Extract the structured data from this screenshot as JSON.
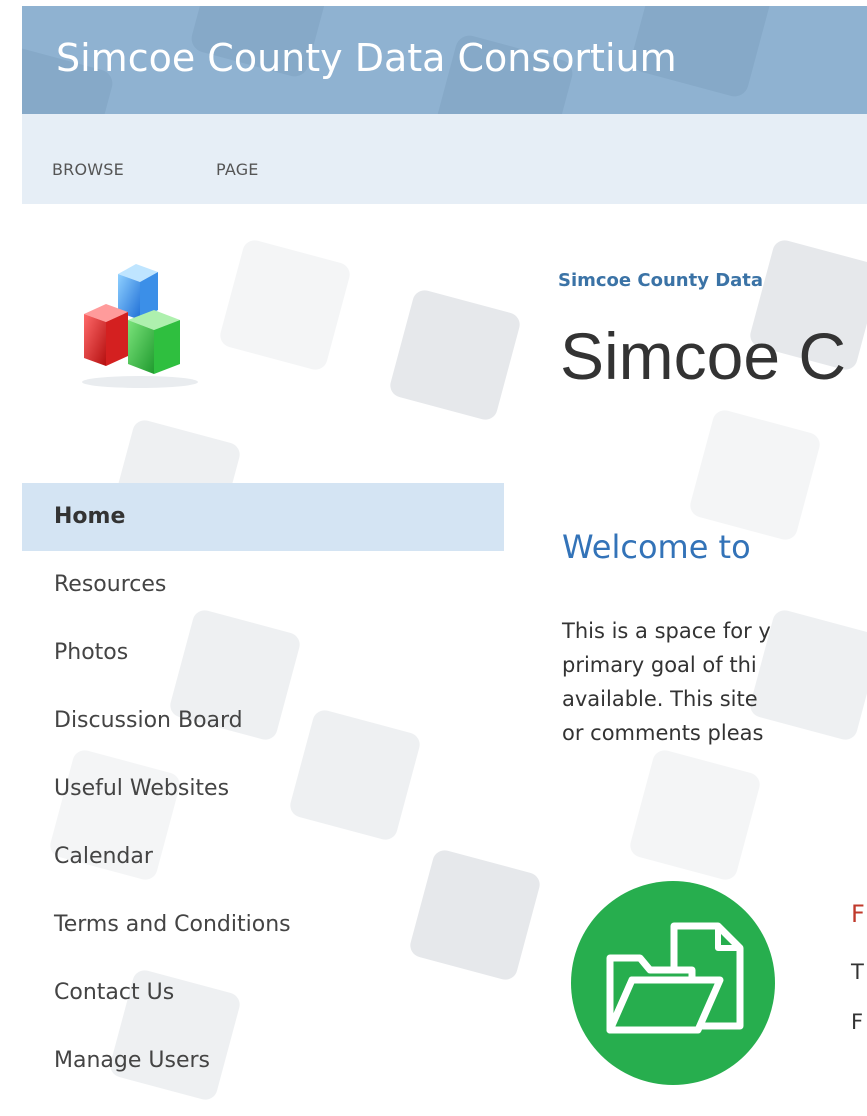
{
  "site": {
    "title": "Simcoe County Data Consortium"
  },
  "ribbon": {
    "tabs": [
      "BROWSE",
      "PAGE"
    ]
  },
  "breadcrumb": "Simcoe County Data",
  "page_title": "Simcoe C",
  "nav": {
    "items": [
      {
        "label": "Home",
        "active": true
      },
      {
        "label": "Resources"
      },
      {
        "label": "Photos"
      },
      {
        "label": "Discussion Board"
      },
      {
        "label": "Useful Websites"
      },
      {
        "label": "Calendar"
      },
      {
        "label": "Terms and Conditions"
      },
      {
        "label": "Contact Us"
      },
      {
        "label": "Manage Users"
      }
    ]
  },
  "main": {
    "welcome": "Welcome to",
    "intro_lines": [
      "This is a space for y",
      "primary goal of thi",
      "available. This site",
      "or comments pleas"
    ],
    "resource_fragments": [
      "F",
      "T",
      "F"
    ]
  },
  "colors": {
    "banner": "#8fb2d1",
    "ribbon": "#e6eef6",
    "nav_active": "#d4e4f3",
    "link": "#3373b8",
    "icon_green": "#27ae4e"
  },
  "icons": {
    "logo": "cubes-logo-icon",
    "resource": "folder-file-icon"
  }
}
